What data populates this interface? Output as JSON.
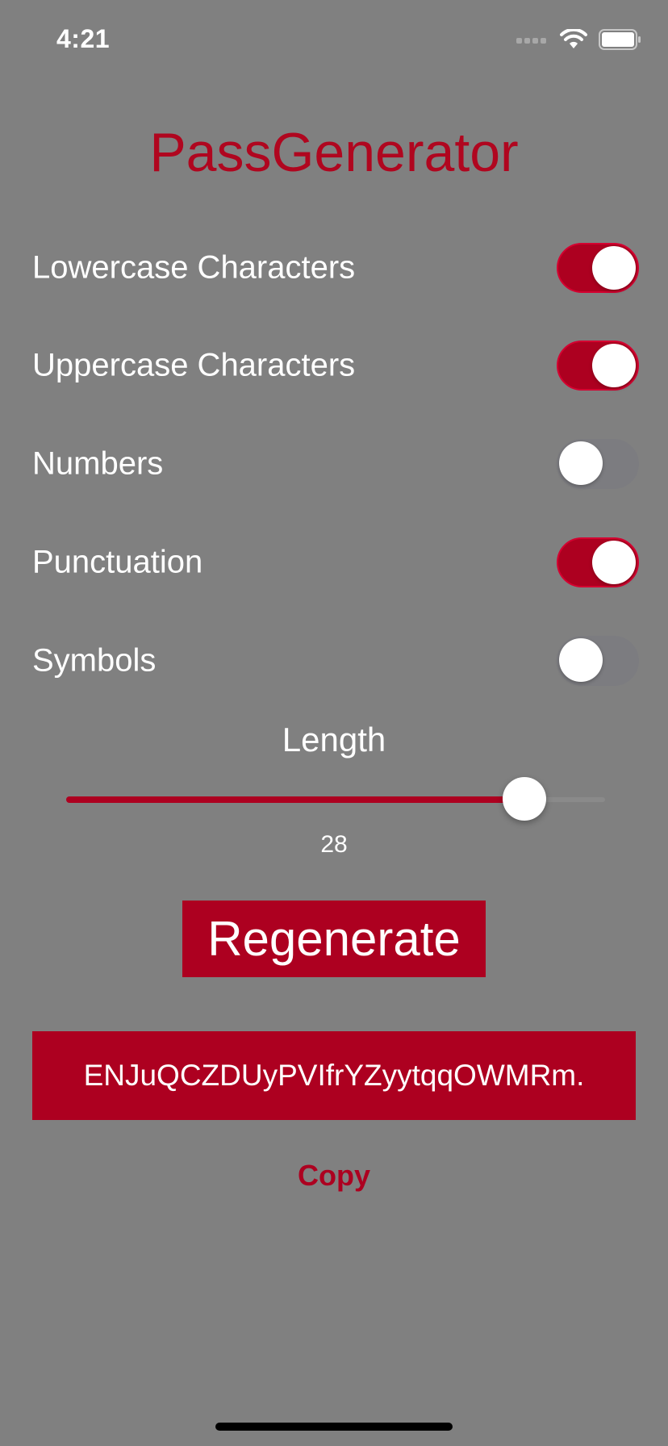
{
  "status_bar": {
    "time": "4:21",
    "icons": [
      "signal-dots-icon",
      "wifi-icon",
      "battery-icon"
    ]
  },
  "app": {
    "title": "PassGenerator",
    "accent_color": "#ad0020",
    "background_color": "#808080"
  },
  "options": [
    {
      "label": "Lowercase Characters",
      "enabled": true
    },
    {
      "label": "Uppercase Characters",
      "enabled": true
    },
    {
      "label": "Numbers",
      "enabled": false
    },
    {
      "label": "Punctuation",
      "enabled": true
    },
    {
      "label": "Symbols",
      "enabled": false
    }
  ],
  "length": {
    "label": "Length",
    "value": "28",
    "slider_fraction": 0.85
  },
  "regenerate_label": "Regenerate",
  "password": "ENJuQCZDUyPVIfrYZyytqqOWMRm.",
  "copy_label": "Copy"
}
